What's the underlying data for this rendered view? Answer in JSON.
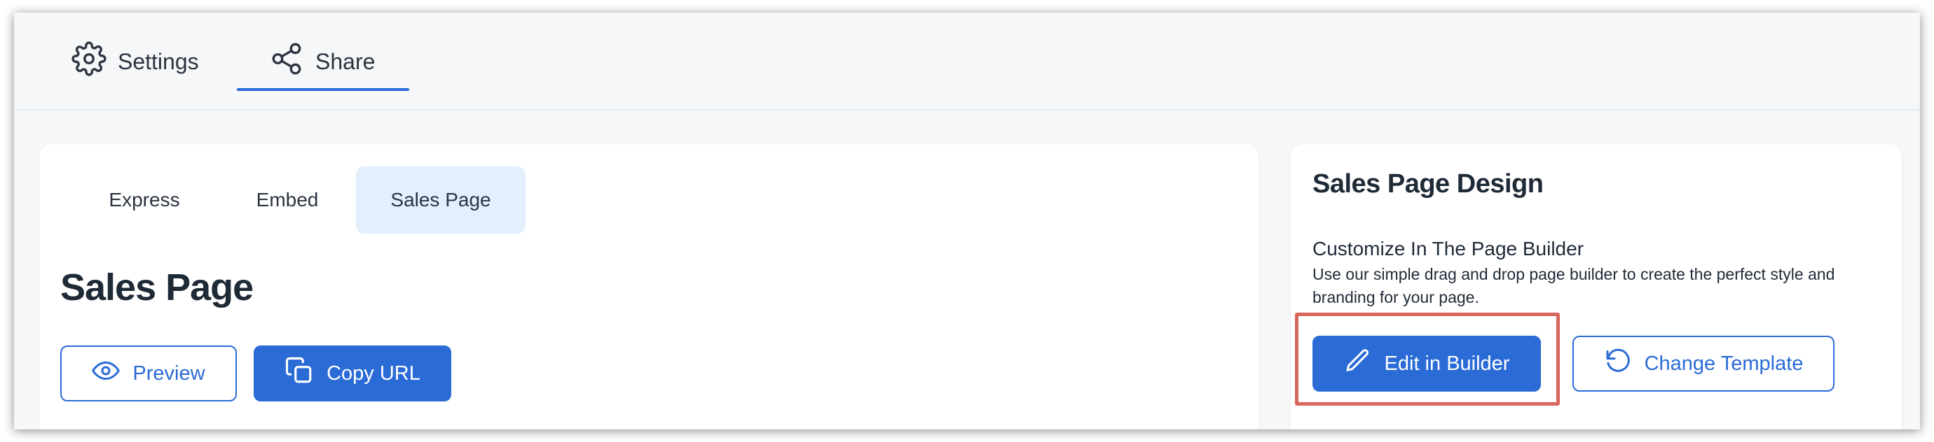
{
  "top_tabs": [
    {
      "label": "Settings",
      "icon": "gear-icon"
    },
    {
      "label": "Share",
      "icon": "share-icon",
      "active": true
    }
  ],
  "sub_tabs": [
    {
      "label": "Express"
    },
    {
      "label": "Embed"
    },
    {
      "label": "Sales Page",
      "active": true
    }
  ],
  "main": {
    "title": "Sales Page",
    "preview_label": "Preview",
    "copy_url_label": "Copy URL"
  },
  "design": {
    "title": "Sales Page Design",
    "subtitle": "Customize In The Page Builder",
    "description": "Use our simple drag and drop page builder to create the perfect style and branding for your page.",
    "edit_label": "Edit in Builder",
    "change_label": "Change Template"
  },
  "colors": {
    "accent": "#2a6bd6",
    "active_tab_bg": "#e3effd",
    "highlight": "#d9665c"
  }
}
